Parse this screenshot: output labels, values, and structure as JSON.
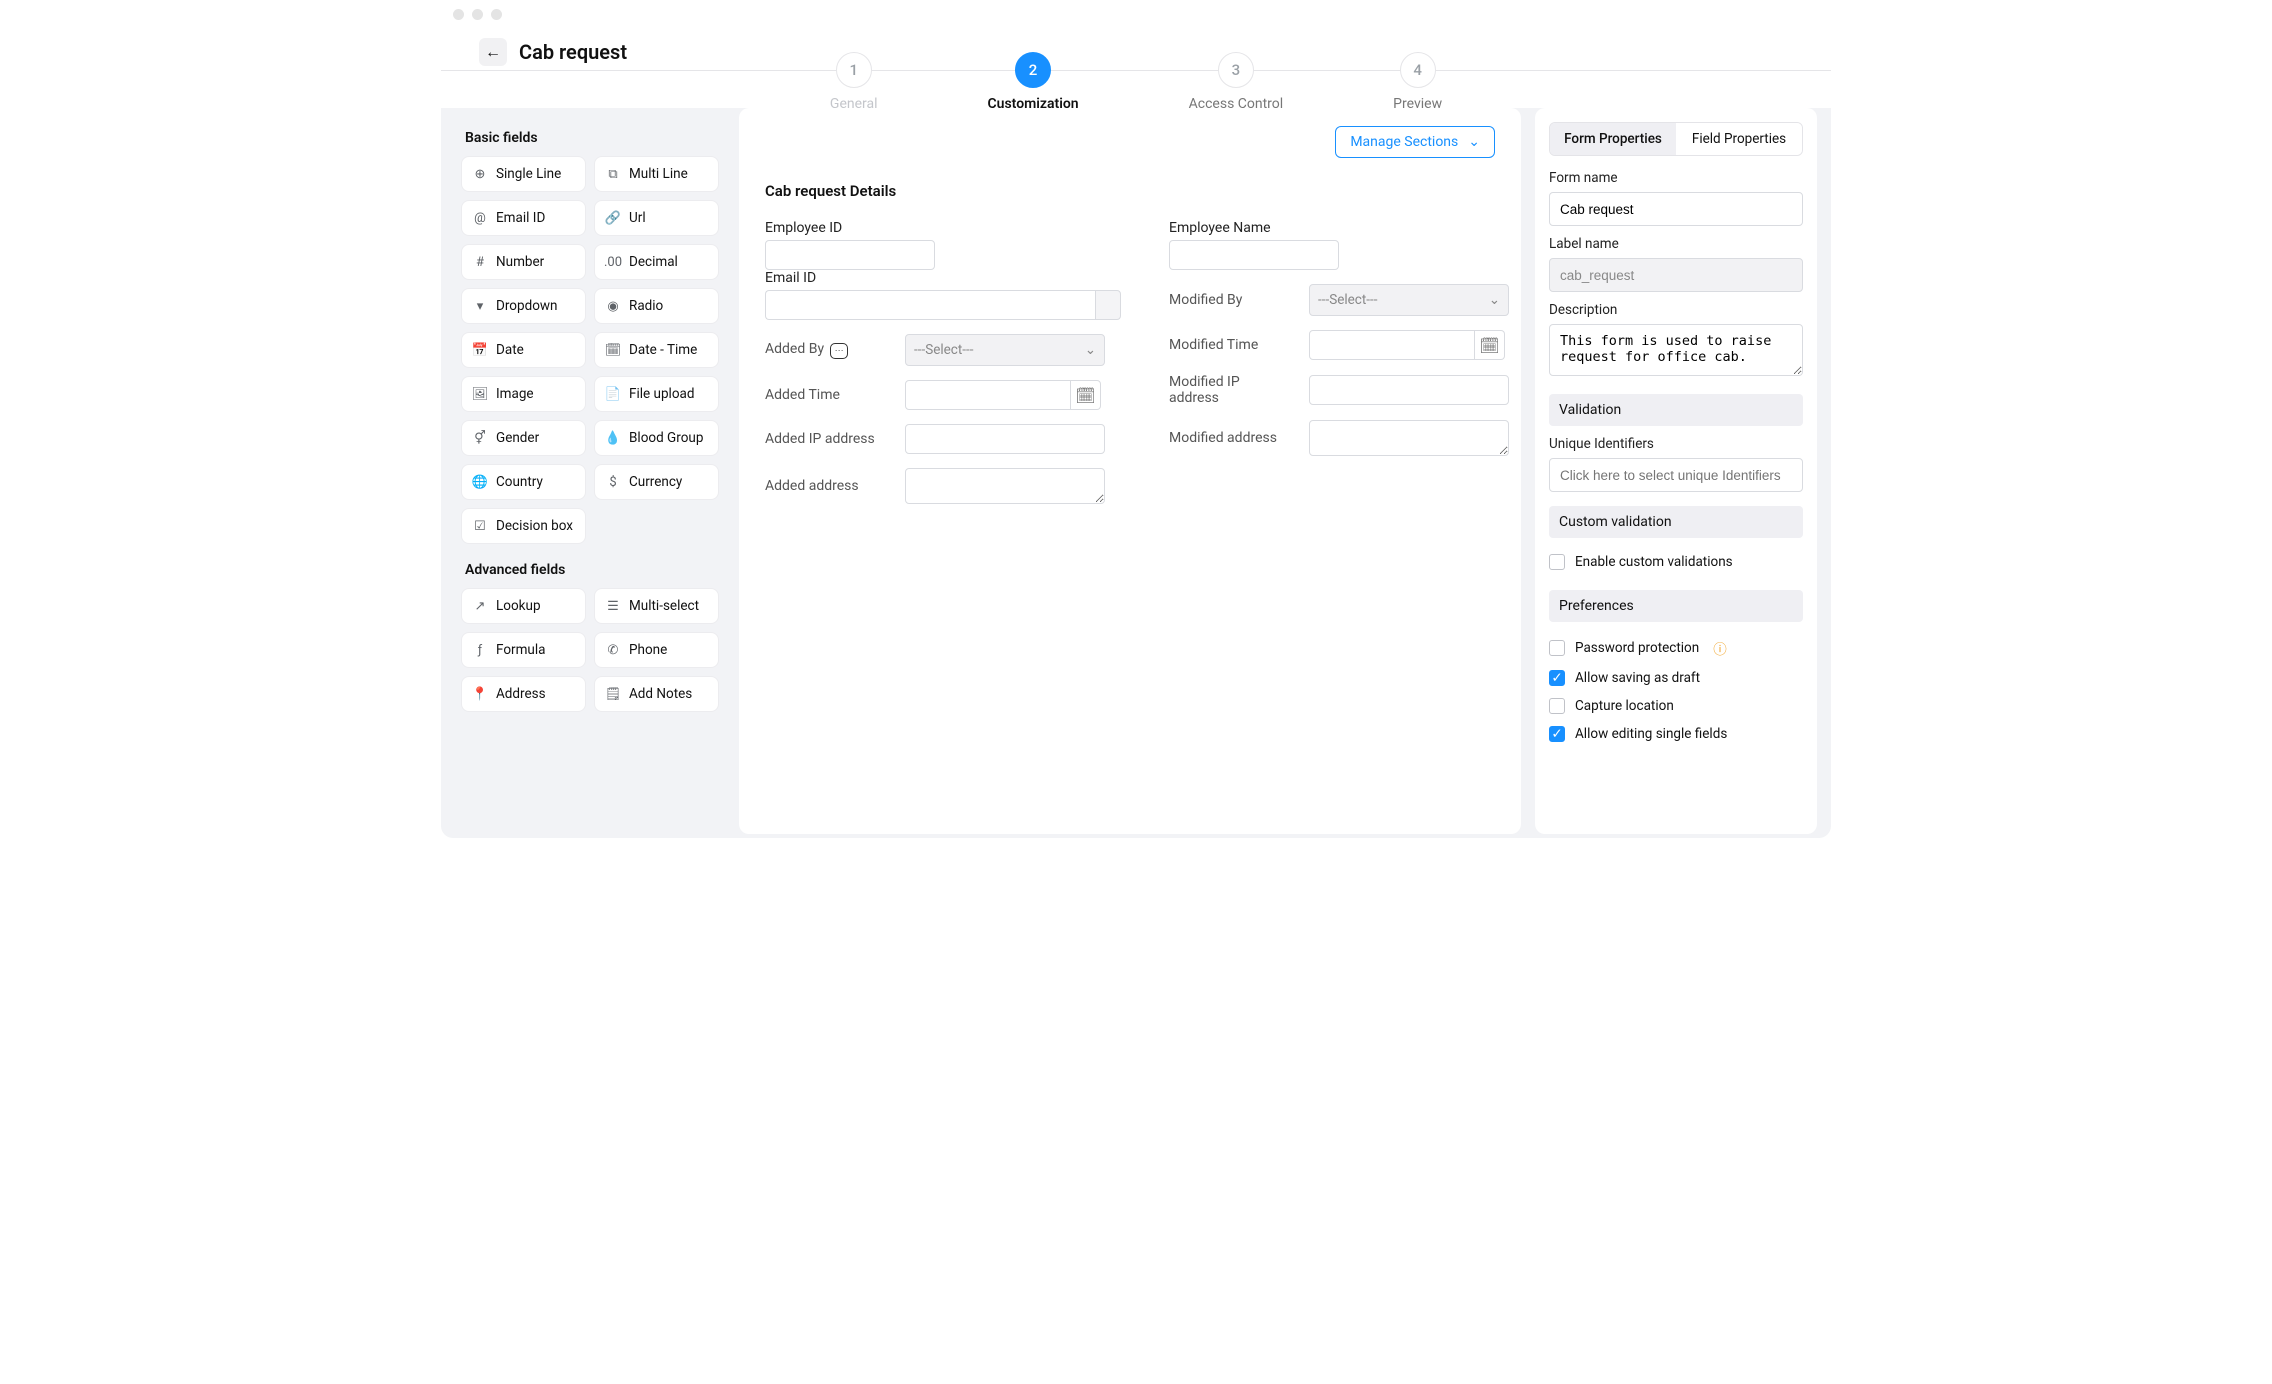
{
  "header": {
    "title": "Cab request"
  },
  "stepper": {
    "steps": [
      {
        "num": "1",
        "label": "General",
        "state": "disabled"
      },
      {
        "num": "2",
        "label": "Customization",
        "state": "active"
      },
      {
        "num": "3",
        "label": "Access Control",
        "state": ""
      },
      {
        "num": "4",
        "label": "Preview",
        "state": ""
      }
    ]
  },
  "basic_fields": {
    "title": "Basic fields",
    "items": [
      {
        "label": "Single Line",
        "icon": "single-line-icon",
        "glyph": "⊕"
      },
      {
        "label": "Multi Line",
        "icon": "multi-line-icon",
        "glyph": "⧉"
      },
      {
        "label": "Email ID",
        "icon": "email-icon",
        "glyph": "@"
      },
      {
        "label": "Url",
        "icon": "url-icon",
        "glyph": "🔗"
      },
      {
        "label": "Number",
        "icon": "number-icon",
        "glyph": "#"
      },
      {
        "label": "Decimal",
        "icon": "decimal-icon",
        "glyph": ".00"
      },
      {
        "label": "Dropdown",
        "icon": "dropdown-icon",
        "glyph": "▾"
      },
      {
        "label": "Radio",
        "icon": "radio-icon",
        "glyph": "◉"
      },
      {
        "label": "Date",
        "icon": "date-icon",
        "glyph": "📅"
      },
      {
        "label": "Date - Time",
        "icon": "datetime-icon",
        "glyph": "🗓"
      },
      {
        "label": "Image",
        "icon": "image-icon",
        "glyph": "🖼"
      },
      {
        "label": "File upload",
        "icon": "file-icon",
        "glyph": "📄"
      },
      {
        "label": "Gender",
        "icon": "gender-icon",
        "glyph": "⚥"
      },
      {
        "label": "Blood Group",
        "icon": "blood-icon",
        "glyph": "💧"
      },
      {
        "label": "Country",
        "icon": "country-icon",
        "glyph": "🌐"
      },
      {
        "label": "Currency",
        "icon": "currency-icon",
        "glyph": "$"
      },
      {
        "label": "Decision box",
        "icon": "decision-icon",
        "glyph": "☑"
      }
    ]
  },
  "advanced_fields": {
    "title": "Advanced fields",
    "items": [
      {
        "label": "Lookup",
        "icon": "lookup-icon",
        "glyph": "↗"
      },
      {
        "label": "Multi-select",
        "icon": "multiselect-icon",
        "glyph": "☰"
      },
      {
        "label": "Formula",
        "icon": "formula-icon",
        "glyph": "ƒ"
      },
      {
        "label": "Phone",
        "icon": "phone-icon",
        "glyph": "✆"
      },
      {
        "label": "Address",
        "icon": "address-icon",
        "glyph": "📍"
      },
      {
        "label": "Add Notes",
        "icon": "notes-icon",
        "glyph": "🗒"
      }
    ]
  },
  "form_canvas": {
    "manage_sections_label": "Manage Sections",
    "section_title": "Cab request Details",
    "left_fields": [
      {
        "name": "employee-id",
        "label": "Employee ID",
        "type": "text",
        "style": "stacked"
      },
      {
        "name": "email-id",
        "label": "Email ID",
        "type": "email",
        "style": "stacked"
      },
      {
        "name": "added-by",
        "label": "Added By",
        "type": "select",
        "placeholder": "---Select---",
        "style": "inline",
        "badge": "⋯"
      },
      {
        "name": "added-time",
        "label": "Added Time",
        "type": "date",
        "style": "inline"
      },
      {
        "name": "added-ip",
        "label": "Added IP address",
        "type": "text",
        "style": "inline"
      },
      {
        "name": "added-address",
        "label": "Added address",
        "type": "textarea",
        "style": "inline"
      }
    ],
    "right_fields": [
      {
        "name": "employee-name",
        "label": "Employee Name",
        "type": "text",
        "style": "stacked"
      },
      {
        "name": "modified-by",
        "label": "Modified By",
        "type": "select",
        "placeholder": "---Select---",
        "style": "inline"
      },
      {
        "name": "modified-time",
        "label": "Modified Time",
        "type": "date",
        "style": "inline"
      },
      {
        "name": "modified-ip",
        "label": "Modified IP address",
        "type": "text",
        "style": "inline"
      },
      {
        "name": "modified-address",
        "label": "Modified address",
        "type": "textarea",
        "style": "inline"
      }
    ]
  },
  "properties": {
    "tabs": {
      "form": "Form Properties",
      "field": "Field Properties"
    },
    "form_name": {
      "label": "Form name",
      "value": "Cab request"
    },
    "label_name": {
      "label": "Label name",
      "value": "cab_request"
    },
    "description": {
      "label": "Description",
      "value": "This form is used to raise request for office cab."
    },
    "validation_header": "Validation",
    "unique_identifiers": {
      "label": "Unique Identifiers",
      "placeholder": "Click here to select unique Identifiers"
    },
    "custom_validation_header": "Custom validation",
    "enable_custom_validations": {
      "label": "Enable custom validations",
      "checked": false
    },
    "preferences_header": "Preferences",
    "preferences": [
      {
        "name": "password-protection",
        "label": "Password protection",
        "checked": false,
        "info": true
      },
      {
        "name": "allow-draft",
        "label": "Allow saving as draft",
        "checked": true
      },
      {
        "name": "capture-location",
        "label": "Capture location",
        "checked": false
      },
      {
        "name": "allow-edit-single",
        "label": "Allow editing single fields",
        "checked": true
      }
    ]
  }
}
